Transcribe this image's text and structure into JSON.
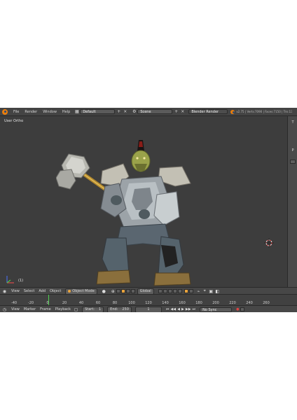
{
  "topbar": {
    "menus": [
      "File",
      "Render",
      "Window",
      "Help"
    ],
    "layout_value": "Default",
    "scene_value": "Scene",
    "render_engine": "Blender Render",
    "stats": "v2.75 | Verts:7090 | Faces:7150 | Tris:13"
  },
  "viewport": {
    "view_label": "User Ortho",
    "object_count": "(1)"
  },
  "right_strip": {
    "tab_top": "T",
    "tab_mid": "P"
  },
  "view3d_header": {
    "menus": [
      "View",
      "Select",
      "Add",
      "Object"
    ],
    "mode": "Object Mode",
    "pivot": "Global"
  },
  "timeline": {
    "ticks": [
      "-40",
      "-20",
      "0",
      "20",
      "40",
      "60",
      "80",
      "100",
      "120",
      "140",
      "160",
      "180",
      "200",
      "220",
      "240",
      "260"
    ],
    "current_frame_value": 1
  },
  "timeline_header": {
    "menus": [
      "View",
      "Marker",
      "Frame",
      "Playback"
    ],
    "start_label": "Start:",
    "start_value": "1",
    "end_label": "End:",
    "end_value": "250",
    "frame_value": "1",
    "sync": "No Sync"
  },
  "colors": {
    "accent": "#e87d0d",
    "timeline_cursor": "#4fd04f",
    "background": "#3d3d3d"
  },
  "icons": [
    "blender-logo-icon",
    "plus-icon",
    "close-icon",
    "menu-icon",
    "camera-icon",
    "rewind-icon",
    "play-icon",
    "forward-icon",
    "record-icon",
    "cursor-3d-icon",
    "axis-icon"
  ]
}
